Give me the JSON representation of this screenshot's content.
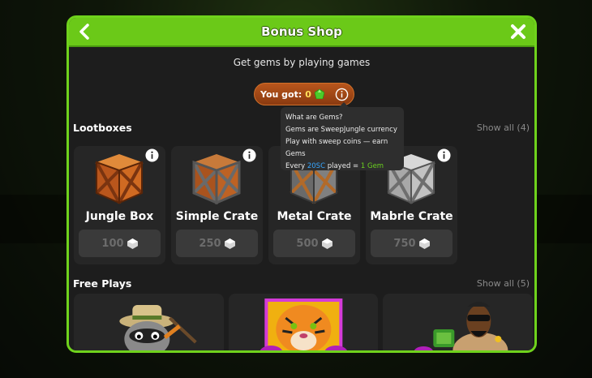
{
  "header": {
    "title": "Bonus Shop"
  },
  "subtitle": "Get gems by playing games",
  "gems": {
    "label": "You got:",
    "value": "0"
  },
  "tooltip": {
    "line1": "What are Gems?",
    "line2": "Gems are SweepJungle currency",
    "line3": "Play with sweep coins — earn Gems",
    "line4_prefix": "Every ",
    "line4_sc": "20SC",
    "line4_mid": " played = ",
    "line4_gem": "1 Gem"
  },
  "lootboxes": {
    "title": "Lootboxes",
    "show_all": "Show all (4)",
    "items": [
      {
        "name": "Jungle Box",
        "price": "100"
      },
      {
        "name": "Simple Crate",
        "price": "250"
      },
      {
        "name": "Metal Crate",
        "price": "500"
      },
      {
        "name": "Mabrle Crate",
        "price": "750"
      }
    ]
  },
  "free_plays": {
    "title": "Free Plays",
    "show_all": "Show all (5)"
  },
  "colors": {
    "accent": "#6bc918",
    "gem_pill": "#9a4414",
    "sc": "#36a6ff"
  }
}
